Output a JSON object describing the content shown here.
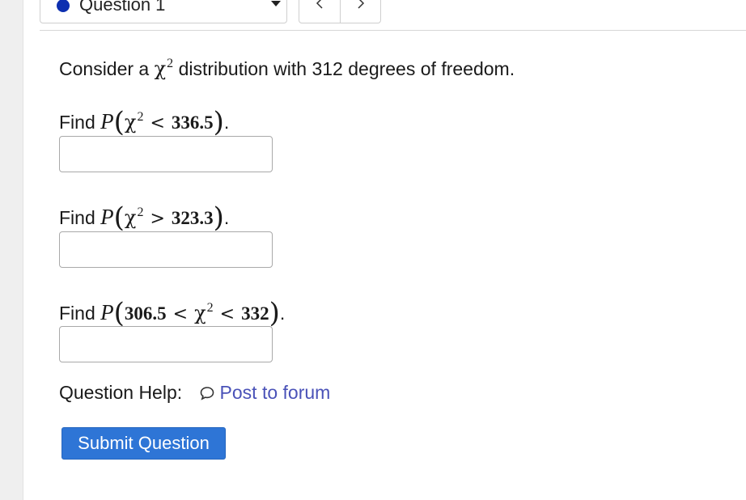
{
  "header": {
    "question_select": {
      "label": "Question 1"
    }
  },
  "problem": {
    "intro_prefix": "Consider a",
    "intro_chi": "χ",
    "intro_exp": "2",
    "intro_suffix": "distribution with 312 degrees of freedom.",
    "parts": [
      {
        "prefix": "Find",
        "P": "P",
        "chi": "χ",
        "exp": "2",
        "lower": "",
        "lower_op": "",
        "upper_op": "<",
        "upper": "336.5",
        "end": "."
      },
      {
        "prefix": "Find",
        "P": "P",
        "chi": "χ",
        "exp": "2",
        "lower": "",
        "lower_op": "",
        "upper_op": ">",
        "upper": "323.3",
        "end": "."
      },
      {
        "prefix": "Find",
        "P": "P",
        "chi": "χ",
        "exp": "2",
        "lower": "306.5",
        "lower_op": "<",
        "upper_op": "<",
        "upper": "332",
        "end": "."
      }
    ],
    "answers": [
      "",
      "",
      ""
    ]
  },
  "help": {
    "label": "Question Help:",
    "forum_link": "Post to forum"
  },
  "submit": {
    "label": "Submit Question"
  },
  "colors": {
    "submit_bg": "#2e75d6",
    "link": "#4a52b8",
    "status_dot": "#0d2fb0"
  },
  "icons": {
    "prev": "chevron-left-icon",
    "next": "chevron-right-icon",
    "forum": "speech-bubble-icon",
    "select": "caret-down-icon"
  }
}
